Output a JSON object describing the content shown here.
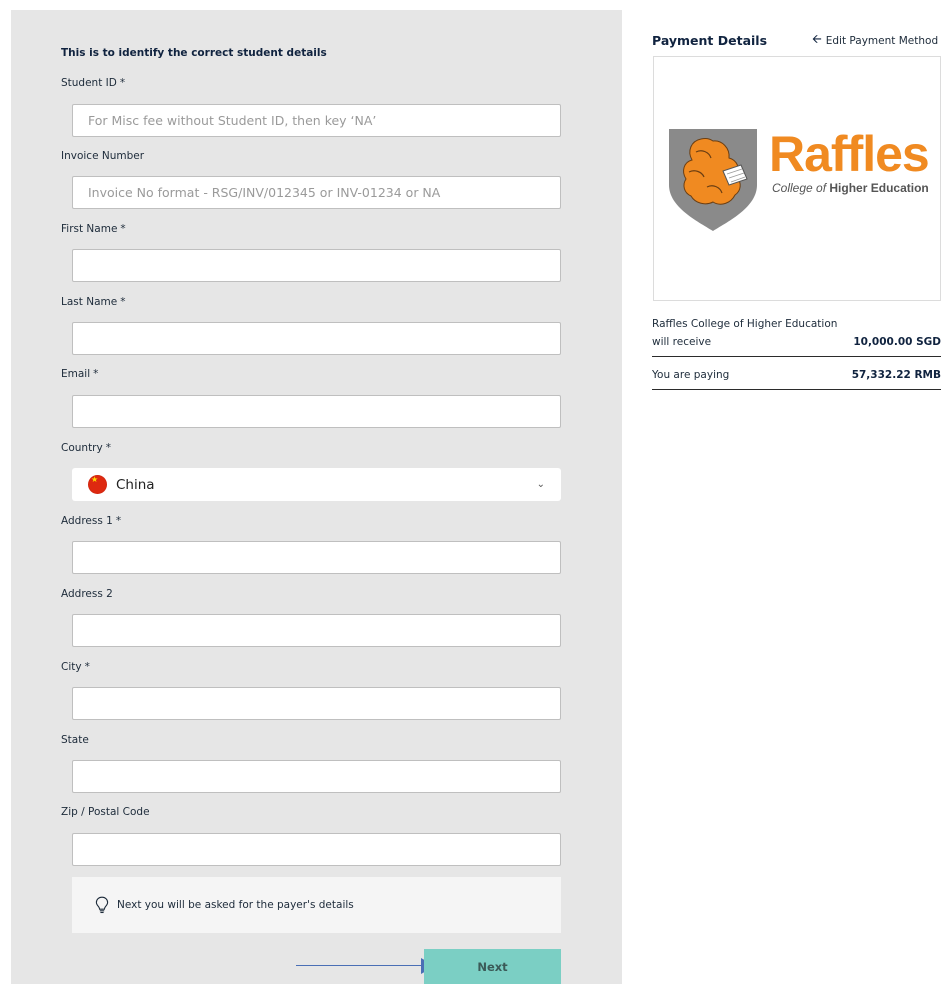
{
  "form": {
    "heading": "This is to identify the correct student details",
    "required_mark": "*",
    "fields": {
      "student_id": {
        "label": "Student ID",
        "placeholder": "For Misc fee without Student ID, then key ‘NA’",
        "value": ""
      },
      "invoice_number": {
        "label": "Invoice Number",
        "placeholder": "Invoice No format - RSG/INV/012345 or INV-01234 or NA",
        "value": ""
      },
      "first_name": {
        "label": "First Name",
        "value": ""
      },
      "last_name": {
        "label": "Last Name",
        "value": ""
      },
      "email": {
        "label": "Email",
        "value": ""
      },
      "country": {
        "label": "Country",
        "value": "China"
      },
      "address1": {
        "label": "Address 1",
        "value": ""
      },
      "address2": {
        "label": "Address 2",
        "value": ""
      },
      "city": {
        "label": "City",
        "value": ""
      },
      "state": {
        "label": "State",
        "value": ""
      },
      "zip": {
        "label": "Zip / Postal Code",
        "value": ""
      }
    },
    "hint": "Next you will be asked for the payer's details",
    "next_label": "Next"
  },
  "payment": {
    "title": "Payment Details",
    "edit_label": "Edit Payment Method",
    "logo": {
      "word": "Raffles",
      "sub_italic": "College of",
      "sub_bold": "Higher Education"
    },
    "recipient_name": "Raffles College of Higher Education",
    "receive_label": "will receive",
    "receive_amount": "10,000.00 SGD",
    "paying_label": "You are paying",
    "paying_amount": "57,332.22 RMB"
  },
  "colors": {
    "panel": "#e6e6e6",
    "next_button": "#7bcfc4",
    "brand_orange": "#f08a21",
    "arrow": "#4a6fb5"
  },
  "icons": [
    "lightbulb-icon",
    "chevron-down-icon",
    "arrow-left-icon",
    "china-flag-icon",
    "shield-lion-icon"
  ]
}
